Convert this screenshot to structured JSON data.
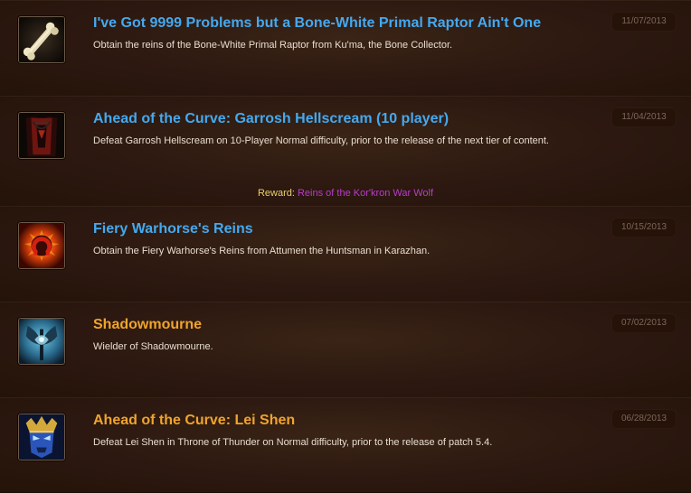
{
  "achievements": [
    {
      "title": "I've Got 9999 Problems but a Bone-White Primal Raptor Ain't One",
      "description": "Obtain the reins of the Bone-White Primal Raptor from Ku'ma, the Bone Collector.",
      "date": "11/07/2013",
      "icon": "bone-icon",
      "title_color": "#44a9ef"
    },
    {
      "title": "Ahead of the Curve: Garrosh Hellscream (10 player)",
      "description": "Defeat Garrosh Hellscream on 10-Player Normal difficulty, prior to the release of the next tier of content.",
      "date": "11/04/2013",
      "icon": "horde-tabard-icon",
      "title_color": "#44a9ef",
      "reward_label": "Reward: ",
      "reward_item": "Reins of the Kor'kron War Wolf",
      "reward_color": "#b93cc9"
    },
    {
      "title": "Fiery Warhorse's Reins",
      "description": "Obtain the Fiery Warhorse's Reins from Attumen the Huntsman in Karazhan.",
      "date": "10/15/2013",
      "icon": "fiery-horseshoe-icon",
      "title_color": "#44a9ef"
    },
    {
      "title": "Shadowmourne",
      "description": "Wielder of Shadowmourne.",
      "date": "07/02/2013",
      "icon": "shadowmourne-axe-icon",
      "title_color": "#f0a42c"
    },
    {
      "title": "Ahead of the Curve: Lei Shen",
      "description": "Defeat Lei Shen in Throne of Thunder on Normal difficulty, prior to the release of patch 5.4.",
      "date": "06/28/2013",
      "icon": "lei-shen-mask-icon",
      "title_color": "#f0a42c"
    }
  ]
}
